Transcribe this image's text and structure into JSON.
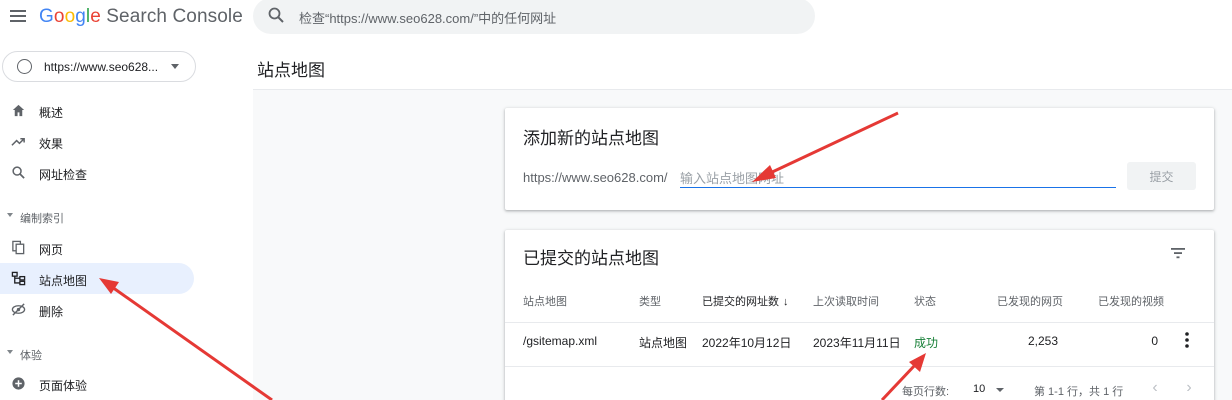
{
  "header": {
    "logo": {
      "g1": "G",
      "g2": "o",
      "g3": "o",
      "g4": "g",
      "g5": "l",
      "g6": "e",
      "rest": " Search Console"
    },
    "search_placeholder": "检查“https://www.seo628.com/”中的任何网址"
  },
  "sidebar": {
    "property": "https://www.seo628...",
    "items_top": [
      {
        "label": "概述",
        "icon": "home-icon"
      },
      {
        "label": "效果",
        "icon": "trending-up-icon"
      },
      {
        "label": "网址检查",
        "icon": "search-icon"
      }
    ],
    "section_index": {
      "label": "编制索引",
      "items": [
        {
          "label": "网页",
          "icon": "pages-icon"
        },
        {
          "label": "站点地图",
          "icon": "sitemap-icon",
          "active": true
        },
        {
          "label": "删除",
          "icon": "removals-icon"
        }
      ]
    },
    "section_experience": {
      "label": "体验",
      "items": [
        {
          "label": "页面体验",
          "icon": "add-circle-icon"
        }
      ]
    }
  },
  "main": {
    "page_title": "站点地图",
    "add_card": {
      "title": "添加新的站点地图",
      "url_prefix": "https://www.seo628.com/",
      "input_placeholder": "输入站点地图网址",
      "submit_label": "提交"
    },
    "submitted_card": {
      "title": "已提交的站点地图",
      "columns": [
        "站点地图",
        "类型",
        "已提交的网址数",
        "上次读取时间",
        "状态",
        "已发现的网页",
        "已发现的视频"
      ],
      "sort_arrow": "↓",
      "rows": [
        {
          "sitemap": "/gsitemap.xml",
          "type": "站点地图",
          "submitted": "2022年10月12日",
          "last_read": "2023年11月11日",
          "status": "成功",
          "pages": "2,253",
          "videos": "0"
        }
      ],
      "pagination": {
        "rows_per_page_label": "每页行数:",
        "rows_per_page": "10",
        "range": "第 1-1 行，共 1 行",
        "prev": "‹",
        "next": "›"
      }
    }
  },
  "colors": {
    "accent": "#1a73e8",
    "active_nav": "#e8f0fe",
    "success": "#188038",
    "annotation_arrow": "#e53935"
  }
}
